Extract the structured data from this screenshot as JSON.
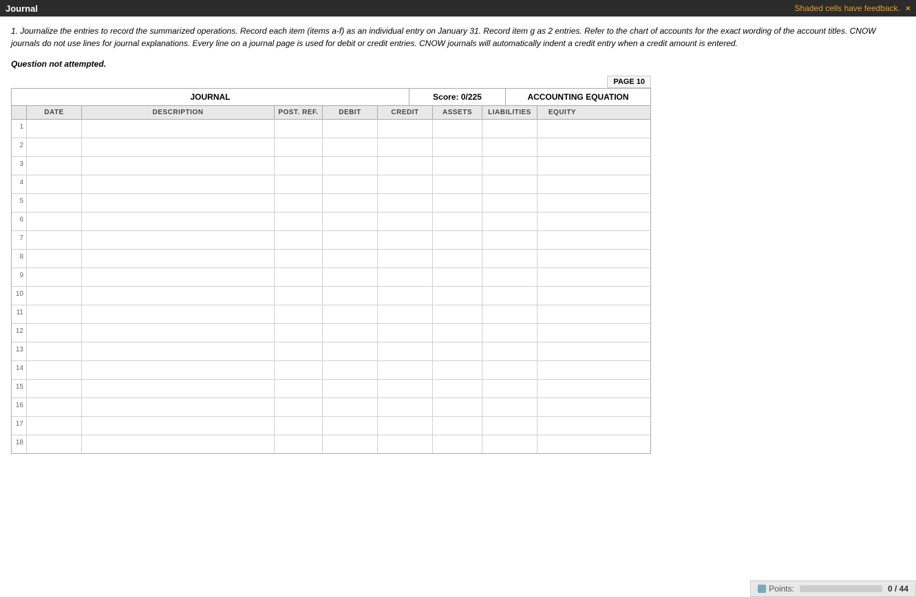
{
  "header": {
    "title": "Journal",
    "feedback_text": "Shaded cells have feedback.",
    "close_label": "×"
  },
  "instructions": {
    "text": "1. Journalize the entries to record the summarized operations. Record each item (items a-f) as an individual entry on January 31. Record item g as 2 entries. Refer to the chart of accounts for the exact wording of the account titles. CNOW journals do not use lines for journal explanations. Every line on a journal page is used for debit or credit entries. CNOW journals will automatically indent a credit entry when a credit amount is entered."
  },
  "question_status": "Question not attempted.",
  "page_indicator": "PAGE 10",
  "journal": {
    "title": "JOURNAL",
    "score_label": "Score: 0/225",
    "accounting_eq_label": "ACCOUNTING EQUATION",
    "columns": {
      "date": "DATE",
      "description": "DESCRIPTION",
      "post_ref": "POST. REF.",
      "debit": "DEBIT",
      "credit": "CREDIT",
      "assets": "ASSETS",
      "liabilities": "LIABILITIES",
      "equity": "EQUITY"
    },
    "row_count": 18
  },
  "footer": {
    "points_label": "Points:",
    "points_value": "0 / 44"
  }
}
